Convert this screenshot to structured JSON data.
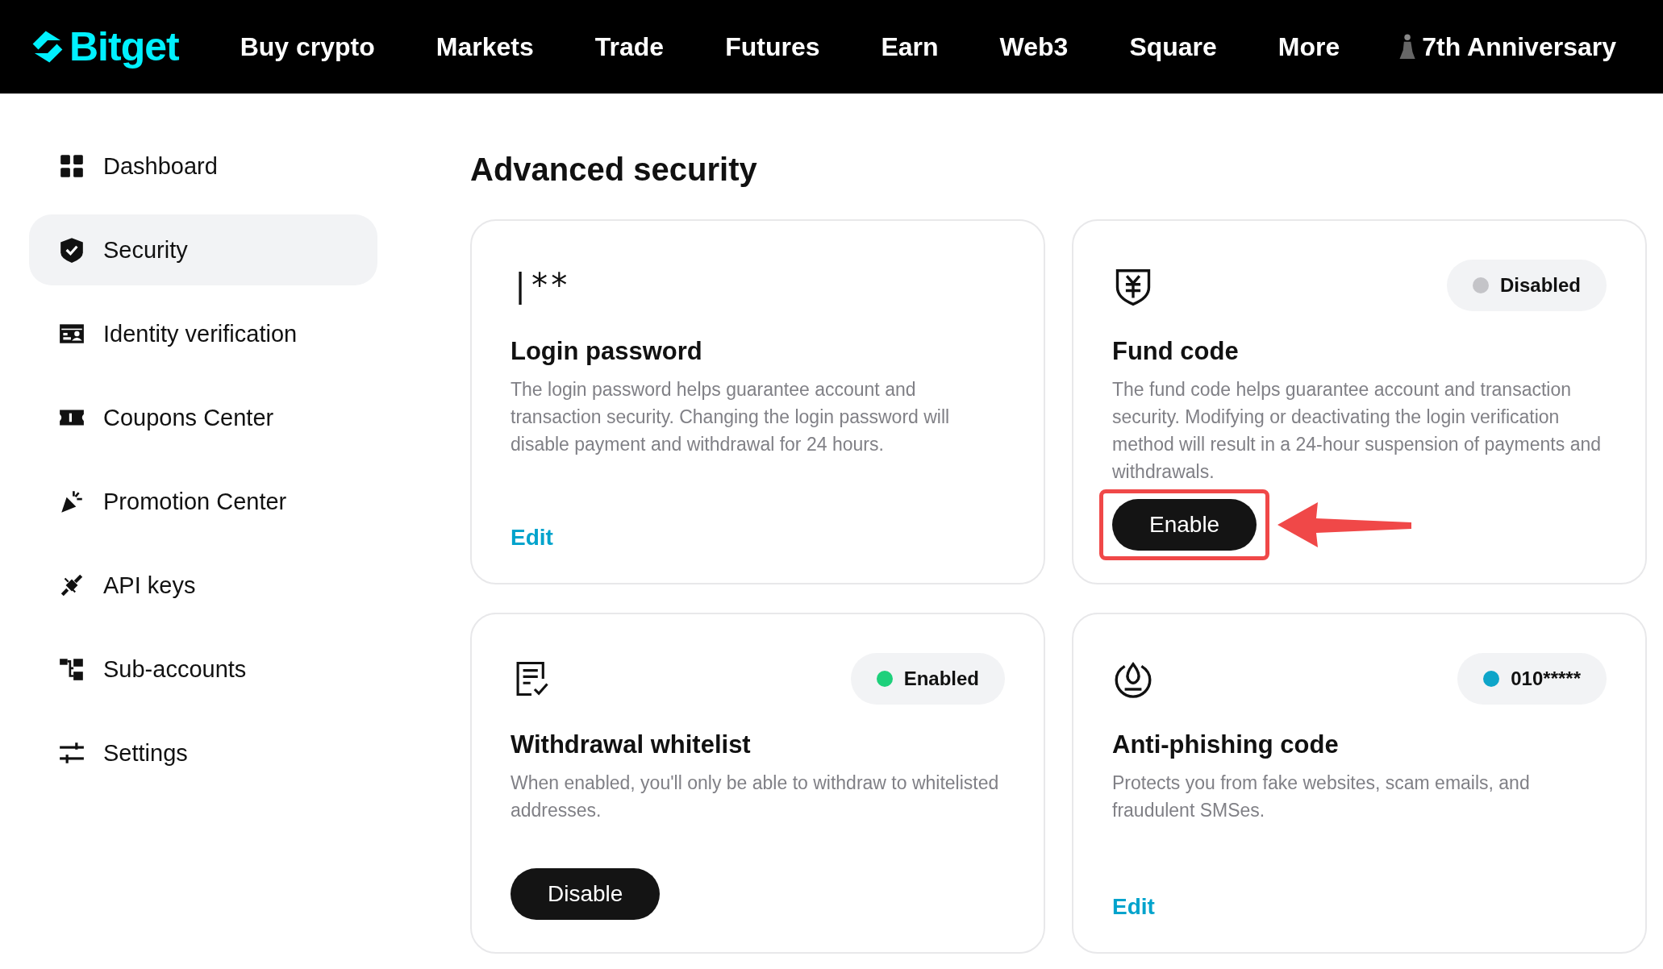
{
  "header": {
    "logo": "Bitget",
    "nav": [
      "Buy crypto",
      "Markets",
      "Trade",
      "Futures",
      "Earn",
      "Web3",
      "Square",
      "More"
    ],
    "promo": "7th Anniversary"
  },
  "sidebar": {
    "items": [
      {
        "label": "Dashboard",
        "selected": false
      },
      {
        "label": "Security",
        "selected": true
      },
      {
        "label": "Identity verification",
        "selected": false
      },
      {
        "label": "Coupons Center",
        "selected": false
      },
      {
        "label": "Promotion Center",
        "selected": false
      },
      {
        "label": "API keys",
        "selected": false
      },
      {
        "label": "Sub-accounts",
        "selected": false
      },
      {
        "label": "Settings",
        "selected": false
      }
    ]
  },
  "page_title": "Advanced security",
  "cards": [
    {
      "icon_text": "|**",
      "title": "Login password",
      "description": "The login password helps guarantee account and transaction security. Changing the login password will disable payment and withdrawal for 24 hours.",
      "action": {
        "kind": "link",
        "label": "Edit"
      },
      "highlighted": false
    },
    {
      "title": "Fund code",
      "status": {
        "label": "Disabled",
        "color": "#c4c4c8"
      },
      "description": "The fund code helps guarantee account and transaction security. Modifying or deactivating the login verification method will result in a 24-hour suspension of payments and withdrawals.",
      "action": {
        "kind": "button",
        "label": "Enable"
      },
      "highlighted": true
    },
    {
      "title": "Withdrawal whitelist",
      "status": {
        "label": "Enabled",
        "color": "#1ed07b"
      },
      "description": "When enabled, you'll only be able to withdraw to whitelisted addresses.",
      "action": {
        "kind": "button",
        "label": "Disable"
      },
      "highlighted": false
    },
    {
      "title": "Anti-phishing code",
      "status": {
        "label": "010*****",
        "color": "#0ea5c9"
      },
      "description": "Protects you from fake websites, scam emails, and fraudulent SMSes.",
      "action": {
        "kind": "link",
        "label": "Edit"
      },
      "highlighted": false
    }
  ]
}
